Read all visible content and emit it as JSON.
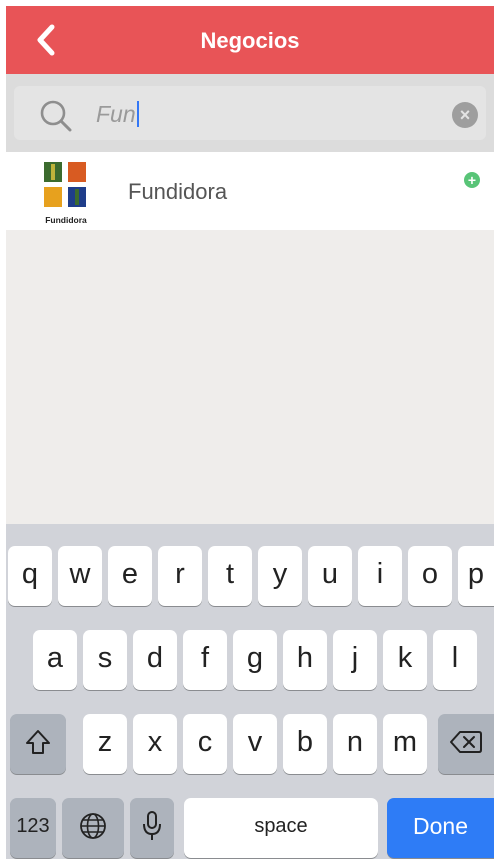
{
  "header": {
    "title": "Negocios",
    "back_icon": "chevron-left-icon"
  },
  "search": {
    "value": "Fun",
    "clear_icon": "clear-icon"
  },
  "results": [
    {
      "name": "Fundidora",
      "logo_text": "Fundidora",
      "action_icon": "add-icon"
    }
  ],
  "keyboard": {
    "row1": [
      "q",
      "w",
      "e",
      "r",
      "t",
      "y",
      "u",
      "i",
      "o",
      "p"
    ],
    "row2": [
      "a",
      "s",
      "d",
      "f",
      "g",
      "h",
      "j",
      "k",
      "l"
    ],
    "row3": [
      "z",
      "x",
      "c",
      "v",
      "b",
      "n",
      "m"
    ],
    "numbers_label": "123",
    "space_label": "space",
    "done_label": "Done"
  },
  "colors": {
    "header": "#e85457",
    "done_key": "#2e7cf6",
    "add_icon": "#58c477"
  }
}
